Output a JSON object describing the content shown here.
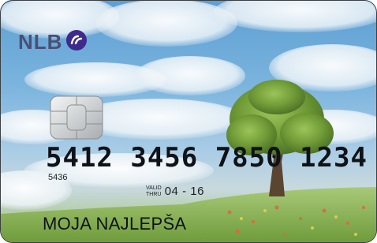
{
  "card": {
    "brand": "NLB",
    "number": "5412 3456 7850 1234",
    "bin_small": "5436",
    "valid_label_top": "VALID",
    "valid_label_bottom": "THRU",
    "expiry": "04 - 16",
    "holder": "MOJA NAJLEPŠA"
  },
  "colors": {
    "brand": "#4a4f75",
    "brand_mark": "#3d2a8c",
    "sky": "#6fa9d8",
    "grass": "#8fb85a"
  },
  "icons": {
    "brand_mark": "nlb-logo-icon",
    "chip": "emv-chip-icon"
  }
}
